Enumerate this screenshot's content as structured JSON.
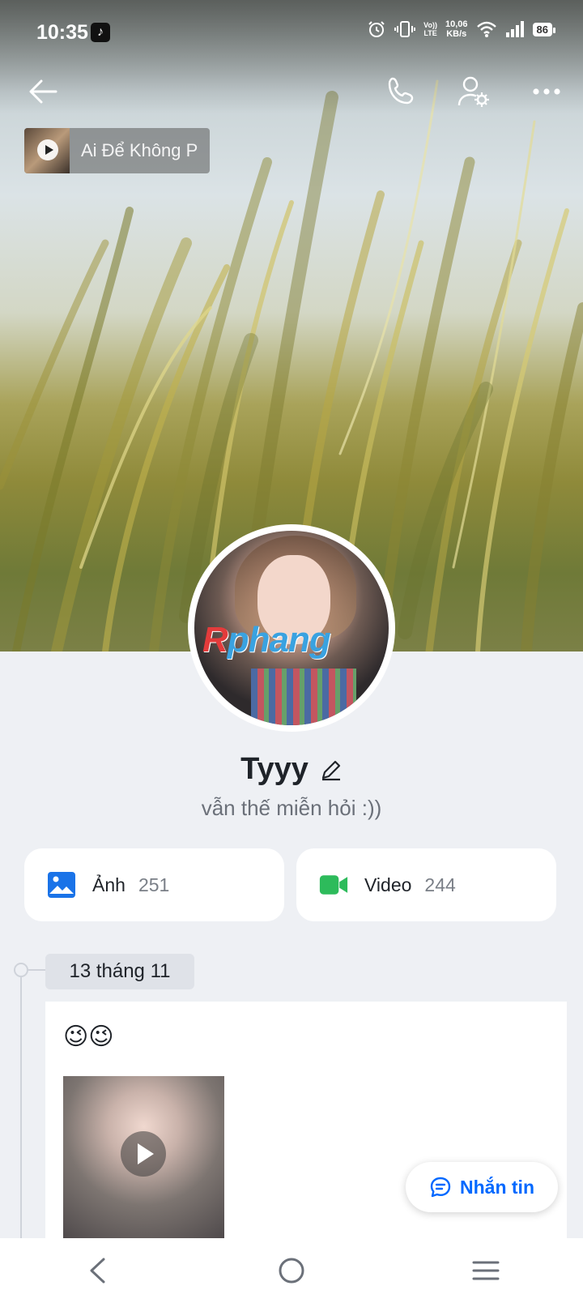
{
  "status_bar": {
    "time": "10:35",
    "net_speed_value": "10,06",
    "net_speed_unit": "KB/s",
    "volte_top": "Vo))",
    "volte_bottom": "LTE",
    "battery": "86"
  },
  "header": {
    "back_icon": "arrow-left-icon",
    "call_icon": "phone-icon",
    "settings_icon": "user-settings-icon",
    "more_icon": "more-horizontal-icon"
  },
  "music": {
    "title": "Ai Để Không P"
  },
  "profile": {
    "name": "Tyyy",
    "bio": "vẫn thế miễn hỏi :))",
    "avatar_watermark_first": "R",
    "avatar_watermark_rest": "phang"
  },
  "media": {
    "photos_label": "Ảnh",
    "photos_count": "251",
    "videos_label": "Video",
    "videos_count": "244"
  },
  "timeline": {
    "date": "13 tháng 11",
    "post_text": "😉😉"
  },
  "message_button": {
    "label": "Nhắn tin"
  },
  "colors": {
    "accent": "#0068ff",
    "video_green": "#2dbb5b",
    "photo_blue": "#1a73e8"
  }
}
